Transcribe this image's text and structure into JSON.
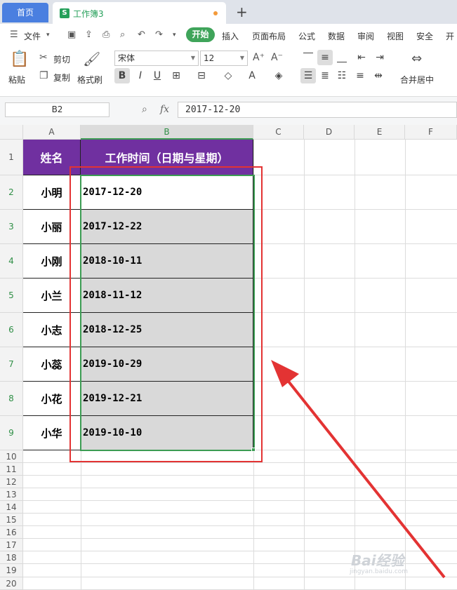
{
  "tabs": {
    "home": "首页",
    "workbook": "工作簿3",
    "new_tab": "+"
  },
  "menu": {
    "file": "文件",
    "start": "开始",
    "items": [
      "插入",
      "页面布局",
      "公式",
      "数据",
      "审阅",
      "视图",
      "安全",
      "开"
    ]
  },
  "toolbar": {
    "paste": "粘贴",
    "cut": "剪切",
    "copy": "复制",
    "format_painter": "格式刷",
    "font_name": "宋体",
    "font_size": "12",
    "merge_center": "合并居中"
  },
  "formula": {
    "name_box": "B2",
    "fx_label": "fx",
    "value": "2017-12-20"
  },
  "columns": [
    "A",
    "B",
    "C",
    "D",
    "E",
    "F"
  ],
  "rows": [
    "1",
    "2",
    "3",
    "4",
    "5",
    "6",
    "7",
    "8",
    "9",
    "10",
    "11",
    "12",
    "13",
    "14",
    "15",
    "16",
    "17",
    "18",
    "19",
    "20"
  ],
  "table": {
    "header_name": "姓名",
    "header_date": "工作时间（日期与星期）",
    "records": [
      {
        "name": "小明",
        "date": "2017-12-20"
      },
      {
        "name": "小丽",
        "date": "2017-12-22"
      },
      {
        "name": "小刚",
        "date": "2018-10-11"
      },
      {
        "name": "小兰",
        "date": "2018-11-12"
      },
      {
        "name": "小志",
        "date": "2018-12-25"
      },
      {
        "name": "小蕊",
        "date": "2019-10-29"
      },
      {
        "name": "小花",
        "date": "2019-12-21"
      },
      {
        "name": "小华",
        "date": "2019-10-10"
      }
    ],
    "header_color": "#7030a0",
    "selection_color": "#3c9c53",
    "annotation_color": "#e33333"
  },
  "watermark": {
    "brand": "Bai经验",
    "url": "jingyan.baidu.com"
  }
}
